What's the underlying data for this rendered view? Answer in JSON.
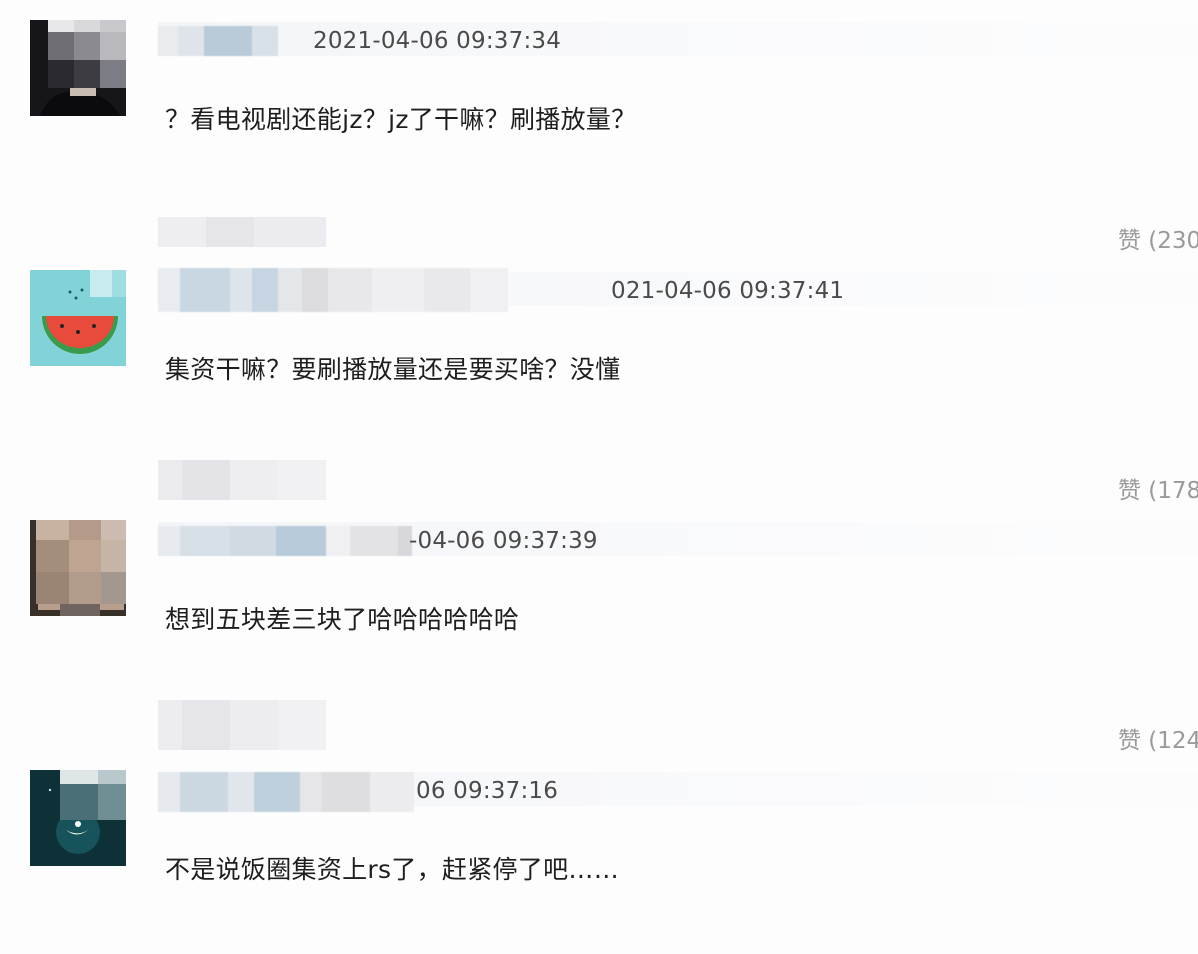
{
  "comments": [
    {
      "time": "2021-04-06 09:37:34",
      "text": "？看电视剧还能jz？jz了干嘛？刷播放量？",
      "likes": "赞 (230"
    },
    {
      "time": "021-04-06 09:37:41",
      "text": "集资干嘛？要刷播放量还是要买啥？没懂",
      "likes": "赞 (178"
    },
    {
      "time": "-04-06 09:37:39",
      "text": "想到五块差三块了哈哈哈哈哈哈",
      "likes": "赞 (124"
    },
    {
      "time": "06 09:37:16",
      "text": "不是说饭圈集资上rs了，赶紧停了吧……"
    }
  ],
  "colors": {
    "text": "#1e1e1e",
    "time": "#4a4a4a",
    "like": "#9a9a9a"
  }
}
